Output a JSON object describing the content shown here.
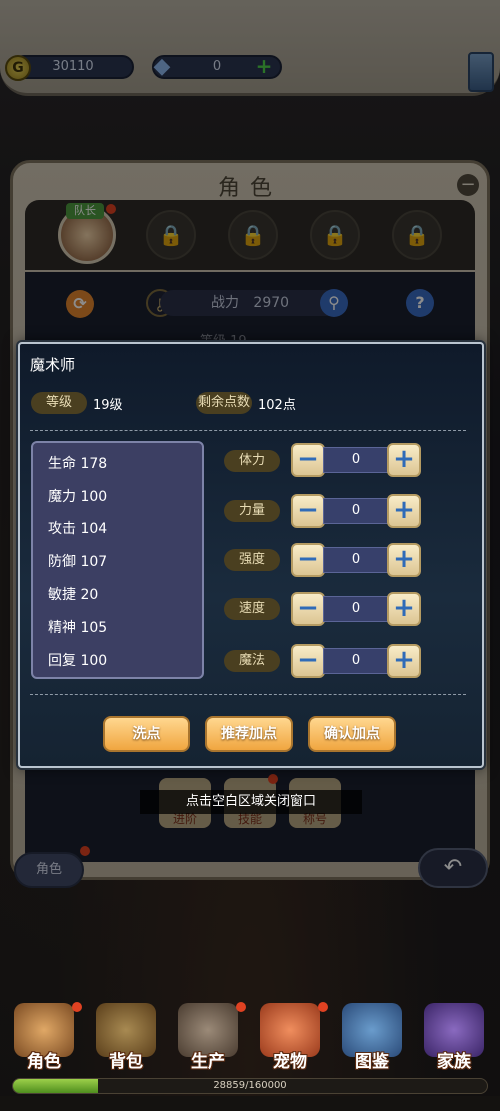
{
  "currency": {
    "coins": "30110",
    "gems": "0"
  },
  "panel": {
    "title": "角色",
    "avatar_tag": "队长",
    "power_label": "战力",
    "power_value": "2970",
    "level_peek": "等级 19"
  },
  "modal": {
    "title": "魔术师",
    "level_label": "等级",
    "level_value": "19级",
    "points_label": "剩余点数",
    "points_value": "102点",
    "stats": [
      {
        "label": "生命",
        "value": "178"
      },
      {
        "label": "魔力",
        "value": "100"
      },
      {
        "label": "攻击",
        "value": "104"
      },
      {
        "label": "防御",
        "value": "107"
      },
      {
        "label": "敏捷",
        "value": "20"
      },
      {
        "label": "精神",
        "value": "105"
      },
      {
        "label": "回复",
        "value": "100"
      }
    ],
    "allocations": [
      {
        "label": "体力",
        "value": "0"
      },
      {
        "label": "力量",
        "value": "0"
      },
      {
        "label": "强度",
        "value": "0"
      },
      {
        "label": "速度",
        "value": "0"
      },
      {
        "label": "魔法",
        "value": "0"
      }
    ],
    "buttons": {
      "reset": "洗点",
      "recommend": "推荐加点",
      "confirm": "确认加点"
    }
  },
  "hint": "点击空白区域关闭窗口",
  "sub_buttons": [
    "进阶",
    "技能",
    "称号"
  ],
  "role_chip": "角色",
  "nav": [
    {
      "label": "角色",
      "icon": "character-icon",
      "color": "#c98a4a",
      "badge": true
    },
    {
      "label": "背包",
      "icon": "backpack-icon",
      "color": "#8a6a3a",
      "badge": false
    },
    {
      "label": "生产",
      "icon": "hammer-icon",
      "color": "#7a6a5a",
      "badge": true
    },
    {
      "label": "宠物",
      "icon": "pet-icon",
      "color": "#d8704a",
      "badge": true
    },
    {
      "label": "图鉴",
      "icon": "book-icon",
      "color": "#4a7aa8",
      "badge": false
    },
    {
      "label": "家族",
      "icon": "family-crest-icon",
      "color": "#6a4a9a",
      "badge": false
    }
  ],
  "xp": {
    "text": "28859/160000",
    "progress": 0.18
  }
}
